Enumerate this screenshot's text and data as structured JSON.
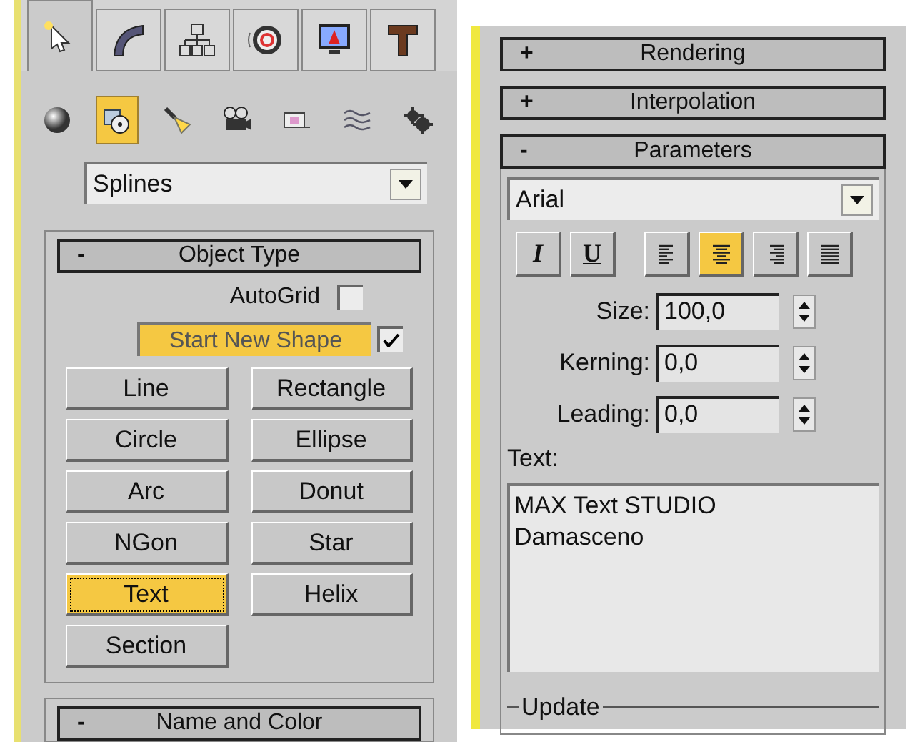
{
  "command_tabs": [
    {
      "kind": "create",
      "selected": true
    },
    {
      "kind": "modify",
      "selected": false
    },
    {
      "kind": "hierarchy",
      "selected": false
    },
    {
      "kind": "motion",
      "selected": false
    },
    {
      "kind": "display",
      "selected": false
    },
    {
      "kind": "utilities",
      "selected": false
    }
  ],
  "categories": [
    {
      "kind": "geometry",
      "selected": false
    },
    {
      "kind": "shapes",
      "selected": true
    },
    {
      "kind": "lights",
      "selected": false
    },
    {
      "kind": "cameras",
      "selected": false
    },
    {
      "kind": "helpers",
      "selected": false
    },
    {
      "kind": "spacewarps",
      "selected": false
    },
    {
      "kind": "systems",
      "selected": false
    }
  ],
  "type_dropdown": {
    "value": "Splines"
  },
  "object_type": {
    "toggle": "-",
    "title": "Object Type",
    "autogrid": {
      "label": "AutoGrid",
      "checked": false
    },
    "start_new_shape": {
      "label": "Start New Shape",
      "on": true,
      "checked": true
    },
    "buttons": [
      {
        "label": "Line",
        "selected": false
      },
      {
        "label": "Rectangle",
        "selected": false
      },
      {
        "label": "Circle",
        "selected": false
      },
      {
        "label": "Ellipse",
        "selected": false
      },
      {
        "label": "Arc",
        "selected": false
      },
      {
        "label": "Donut",
        "selected": false
      },
      {
        "label": "NGon",
        "selected": false
      },
      {
        "label": "Star",
        "selected": false
      },
      {
        "label": "Text",
        "selected": true
      },
      {
        "label": "Helix",
        "selected": false
      },
      {
        "label": "Section",
        "selected": false
      }
    ]
  },
  "name_and_color": {
    "toggle": "-",
    "title": "Name and Color"
  },
  "rollouts": [
    {
      "toggle": "+",
      "title": "Rendering"
    },
    {
      "toggle": "+",
      "title": "Interpolation"
    },
    {
      "toggle": "-",
      "title": "Parameters"
    }
  ],
  "parameters": {
    "font": {
      "value": "Arial"
    },
    "style_buttons": [
      {
        "kind": "text",
        "label": "I",
        "selected": false
      },
      {
        "kind": "text",
        "label": "U",
        "selected": false
      },
      {
        "kind": "align-left",
        "selected": false
      },
      {
        "kind": "align-center",
        "selected": true
      },
      {
        "kind": "align-right",
        "selected": false
      },
      {
        "kind": "justify",
        "selected": false
      }
    ],
    "spinners": [
      {
        "label": "Size:",
        "value": "100,0"
      },
      {
        "label": "Kerning:",
        "value": "0,0"
      },
      {
        "label": "Leading:",
        "value": "0,0"
      }
    ],
    "text_label": "Text:",
    "text_lines": [
      "MAX Text STUDIO",
      "Damasceno"
    ],
    "update_group": "Update"
  }
}
